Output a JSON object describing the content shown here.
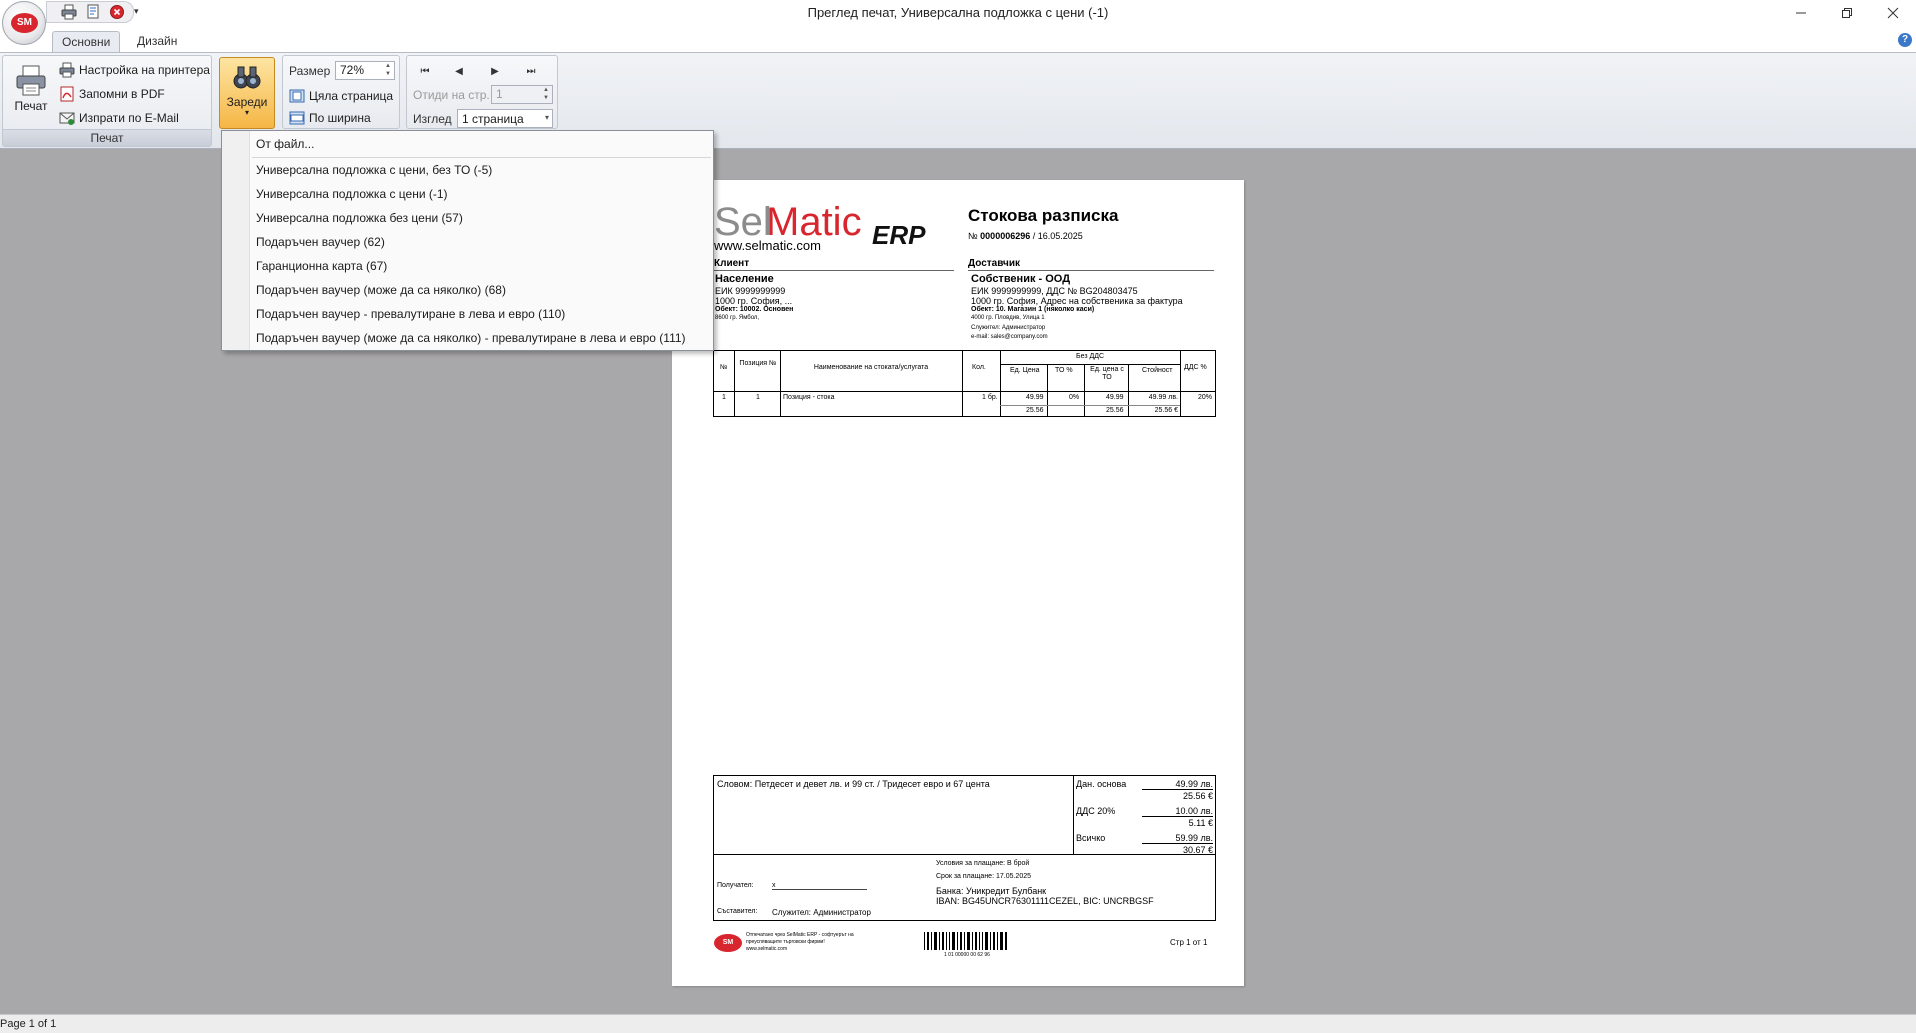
{
  "window": {
    "title": "Преглед печат, Универсална подложка с цени (-1)",
    "app_logo": "SM"
  },
  "tabs": [
    {
      "label": "Основни",
      "active": true
    },
    {
      "label": "Дизайн",
      "active": false
    }
  ],
  "ribbon": {
    "print_group": {
      "caption": "Печат",
      "print_label": "Печат",
      "printer_settings_label": "Настройка на принтера",
      "save_pdf_label": "Запомни в PDF",
      "send_email_label": "Изпрати по E-Mail"
    },
    "load": {
      "label": "Зареди"
    },
    "zoom": {
      "size_label": "Размер",
      "size_value": "72%",
      "whole_page_label": "Цяла страница",
      "page_width_label": "По ширина"
    },
    "navigation": {
      "goto_label": "Отиди на стр.",
      "goto_value": "1",
      "view_label": "Изглед",
      "view_value": "1 страница"
    }
  },
  "dropdown": {
    "from_file": "От файл...",
    "items": [
      "Универсална подложка с цени, без ТО (-5)",
      "Универсална подложка с цени (-1)",
      "Универсална подложка без цени (57)",
      "Подаръчен ваучер (62)",
      "Гаранционна карта (67)",
      "Подаръчен ваучер (може да са няколко) (68)",
      "Подаръчен ваучер - превалутиране в лева и евро (110)",
      "Подаръчен ваучер (може да са няколко) - превалутиране в лева и евро (111)"
    ]
  },
  "document": {
    "logo_sel": "Sel",
    "logo_matic": "Matic",
    "logo_erp": "ERP",
    "website": "www.selmatic.com",
    "doc_title": "Стокова разписка",
    "doc_number_prefix": "№",
    "doc_number": "0000006296",
    "doc_date": "/ 16.05.2025",
    "client": {
      "heading": "Клиент",
      "name": "Население",
      "eik": "ЕИК 9999999999",
      "address": "1000 гр. София, ...",
      "object": "Обект: 10002. Основен",
      "object_address": "8600 гр. Ямбол,"
    },
    "supplier": {
      "heading": "Доставчик",
      "name": "Собственик - ООД",
      "eik": "ЕИК 9999999999, ДДС № BG204803475",
      "address": "1000 гр. София, Адрес на собственика за фактура",
      "object": "Обект: 10. Магазин 1 (няколко каси)",
      "object_address": "4000 гр. Пловдив, Улица 1",
      "employee": "Служител: Администратор",
      "email": "e-mail: sales@company.com"
    },
    "table": {
      "headers": {
        "no": "№",
        "position": "Позиция №",
        "name": "Наименование на стоката/услугата",
        "qty": "Кол.",
        "no_vat": "Без ДДС",
        "unit_price": "Ед. Цена",
        "to_pct": "ТО %",
        "unit_price_to": "Ед. цена с ТО",
        "value": "Стойност",
        "vat_pct": "ДДС %"
      },
      "rows": [
        {
          "no": "1",
          "position": "1",
          "name": "Позиция - стока",
          "qty": "1 бр.",
          "unit_price": "49.99",
          "unit_price_eur": "25.56",
          "to_pct": "0%",
          "unit_price_to": "49.99",
          "unit_price_to_eur": "25.56",
          "value": "49.99 лв.",
          "value_eur": "25.56 €",
          "vat_pct": "20%"
        }
      ]
    },
    "totals": {
      "words": "Словом: Петдесет и девет лв. и 99 ст. / Тридесет евро и 67 цента",
      "tax_base_label": "Дан. основа",
      "tax_base_bgn": "49.99 лв.",
      "tax_base_eur": "25.56 €",
      "vat_label": "ДДС 20%",
      "vat_bgn": "10.00 лв.",
      "vat_eur": "5.11 €",
      "total_label": "Всичко",
      "total_bgn": "59.99 лв.",
      "total_eur": "30.67 €"
    },
    "footer": {
      "payment_terms": "Условия за плащане: В брой",
      "payment_due": "Срок за плащане: 17.05.2025",
      "bank": "Банка: Уникредит Булбанк",
      "iban": "IBAN: BG45UNCR76301111CEZEL, BIC: UNCRBGSF",
      "recipient_label": "Получател:",
      "recipient_value": "x",
      "compiler_label": "Съставител:",
      "compiler_value": "Служител: Администратор",
      "printed_by_line1": "Отпечатано чрез SelMatic ERP - софтуерът на",
      "printed_by_line2": "преуспяващите търговски фирми!",
      "printed_by_line3": "www.selmatic.com",
      "barcode_text": "1 01 00000 00 62 96",
      "page_counter": "Стр 1 от 1"
    }
  },
  "status_bar": {
    "text": "Page 1 of 1"
  },
  "colors": {
    "logo_red": "#d8262e",
    "accent_orange": "#f5b645",
    "workspace_gray": "#a8a7a9"
  }
}
